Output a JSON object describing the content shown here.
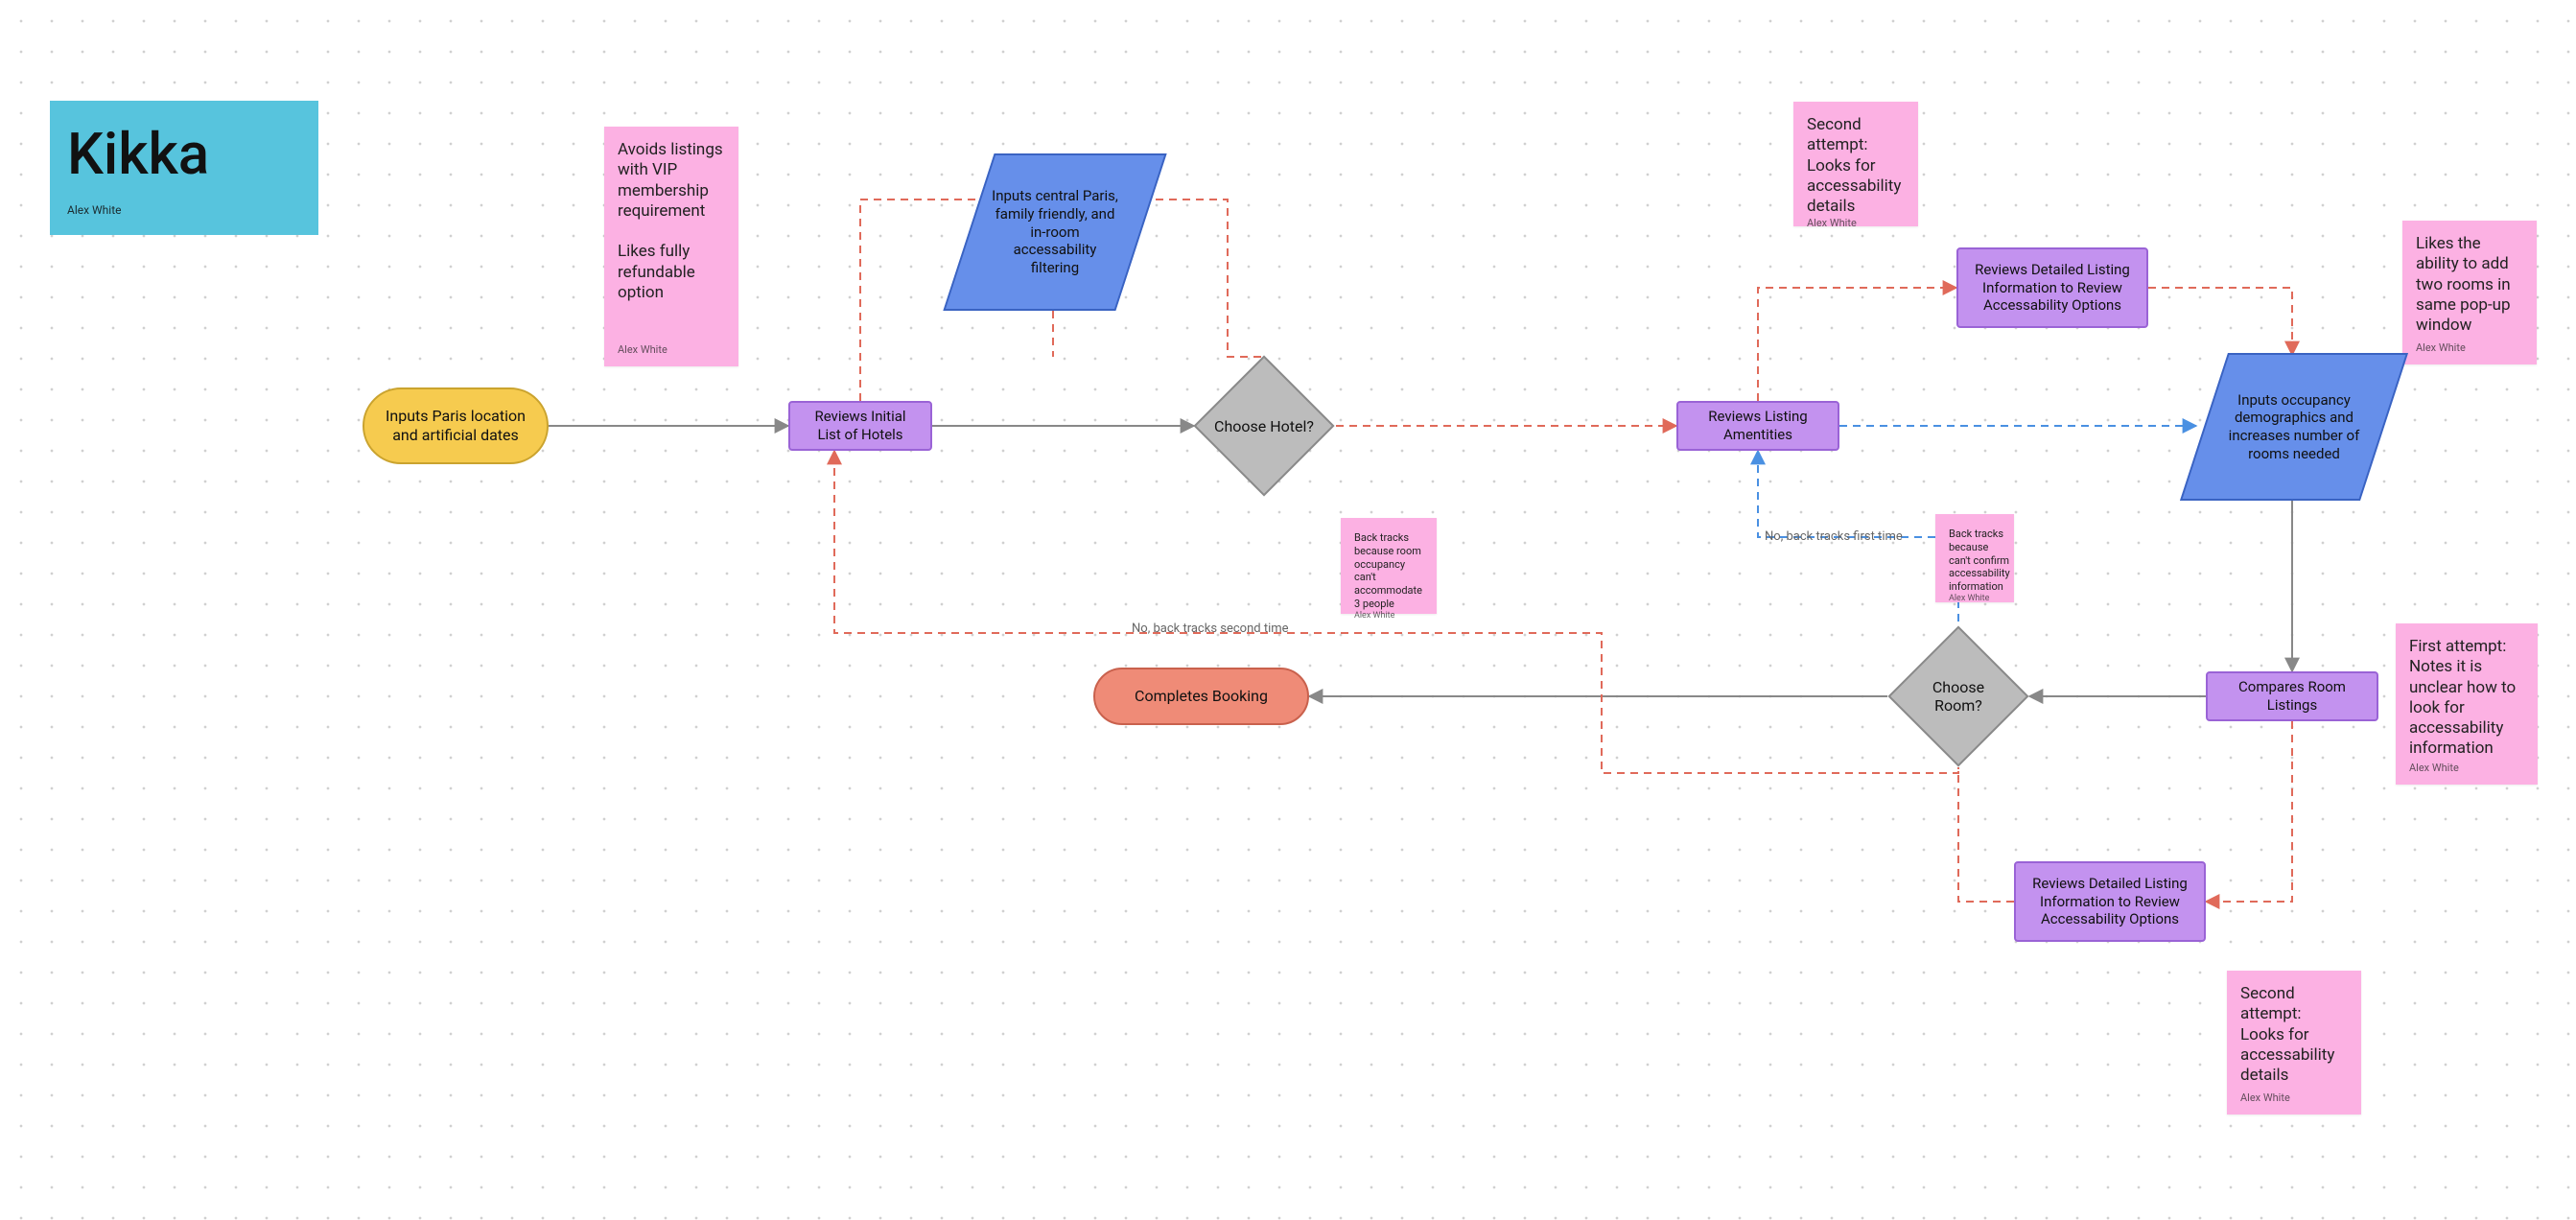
{
  "author": "Alex White",
  "title_card": {
    "title": "Kikka"
  },
  "nodes": {
    "start": "Inputs Paris location and artificial dates",
    "reviewsInitial": "Reviews Initial List of Hotels",
    "inputFilters": "Inputs central Paris, family friendly, and in-room accessability filtering",
    "chooseHotel": "Choose Hotel?",
    "reviewsAmenities": "Reviews Listing Amentities",
    "reviewsDetailUpper": "Reviews Detailed Listing Information to Review Accessability Options",
    "inputsOccupancy": "Inputs occupancy demographics and increases number of rooms needed",
    "comparesRooms": "Compares Room Listings",
    "chooseRoom": "Choose Room?",
    "reviewsDetailLower": "Reviews Detailed Listing Information to Review Accessability Options",
    "completesBooking": "Completes Booking"
  },
  "stickies": {
    "avoidsVIP": "Avoids listings with VIP membership requirement\n\nLikes fully refundable option",
    "secondAttemptTop": "Second attempt: Looks for accessability details",
    "likesTwoRooms": "Likes the ability to add two rooms in same pop-up window",
    "backtrackOccupancy": "Back tracks because room occupancy can't accommodate 3 people",
    "backtrackAccess": "Back tracks because can't confirm accessability information",
    "firstAttempt": "First attempt: Notes it is unclear how to look for accessability information",
    "secondAttemptBottom": "Second attempt: Looks for accessability details"
  },
  "edgeLabels": {
    "noFirst": "No, back tracks first time",
    "noSecond": "No, back tracks second time"
  },
  "colors": {
    "sticky": "#fcb1e3",
    "titleCard": "#57c4dd",
    "terminatorStart": "#f6cb4f",
    "terminatorEnd": "#ef8b77",
    "process": "#c392ef",
    "input": "#668fea",
    "decision": "#bcbcbc",
    "solidEdge": "#888888",
    "dashedRed": "#e06a5a",
    "dashedBlue": "#4a90e2"
  }
}
